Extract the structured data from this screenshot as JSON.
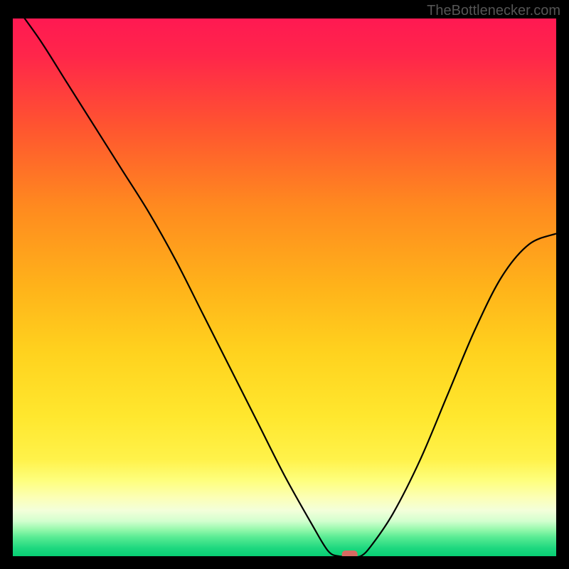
{
  "watermark": "TheBottlenecker.com",
  "chart_data": {
    "type": "line",
    "title": "",
    "xlabel": "",
    "ylabel": "",
    "xlim": [
      0,
      100
    ],
    "ylim": [
      0,
      100
    ],
    "background_gradient_stops": [
      {
        "offset": 0.0,
        "color": "#ff1952"
      },
      {
        "offset": 0.07,
        "color": "#ff264a"
      },
      {
        "offset": 0.2,
        "color": "#ff5430"
      },
      {
        "offset": 0.35,
        "color": "#ff8a1f"
      },
      {
        "offset": 0.5,
        "color": "#ffb31a"
      },
      {
        "offset": 0.62,
        "color": "#ffd21e"
      },
      {
        "offset": 0.74,
        "color": "#ffe72e"
      },
      {
        "offset": 0.82,
        "color": "#fff24a"
      },
      {
        "offset": 0.86,
        "color": "#feff7e"
      },
      {
        "offset": 0.89,
        "color": "#fcffb4"
      },
      {
        "offset": 0.915,
        "color": "#f3ffda"
      },
      {
        "offset": 0.935,
        "color": "#d2ffce"
      },
      {
        "offset": 0.95,
        "color": "#97f9ad"
      },
      {
        "offset": 0.965,
        "color": "#58eb93"
      },
      {
        "offset": 0.985,
        "color": "#1ed87f"
      },
      {
        "offset": 1.0,
        "color": "#07cf74"
      }
    ],
    "series": [
      {
        "name": "curve",
        "x": [
          0,
          5,
          10,
          15,
          20,
          25,
          30,
          35,
          40,
          45,
          50,
          55,
          58,
          60,
          62,
          64,
          66,
          70,
          75,
          80,
          85,
          90,
          95,
          100
        ],
        "values": [
          103,
          96,
          88,
          80,
          72,
          64,
          55,
          45,
          35,
          25,
          15,
          6,
          1,
          0,
          0,
          0,
          2,
          8,
          18,
          30,
          42,
          52,
          58,
          60
        ]
      }
    ],
    "marker": {
      "x": 62,
      "y": 0,
      "color": "#d86a62"
    }
  }
}
